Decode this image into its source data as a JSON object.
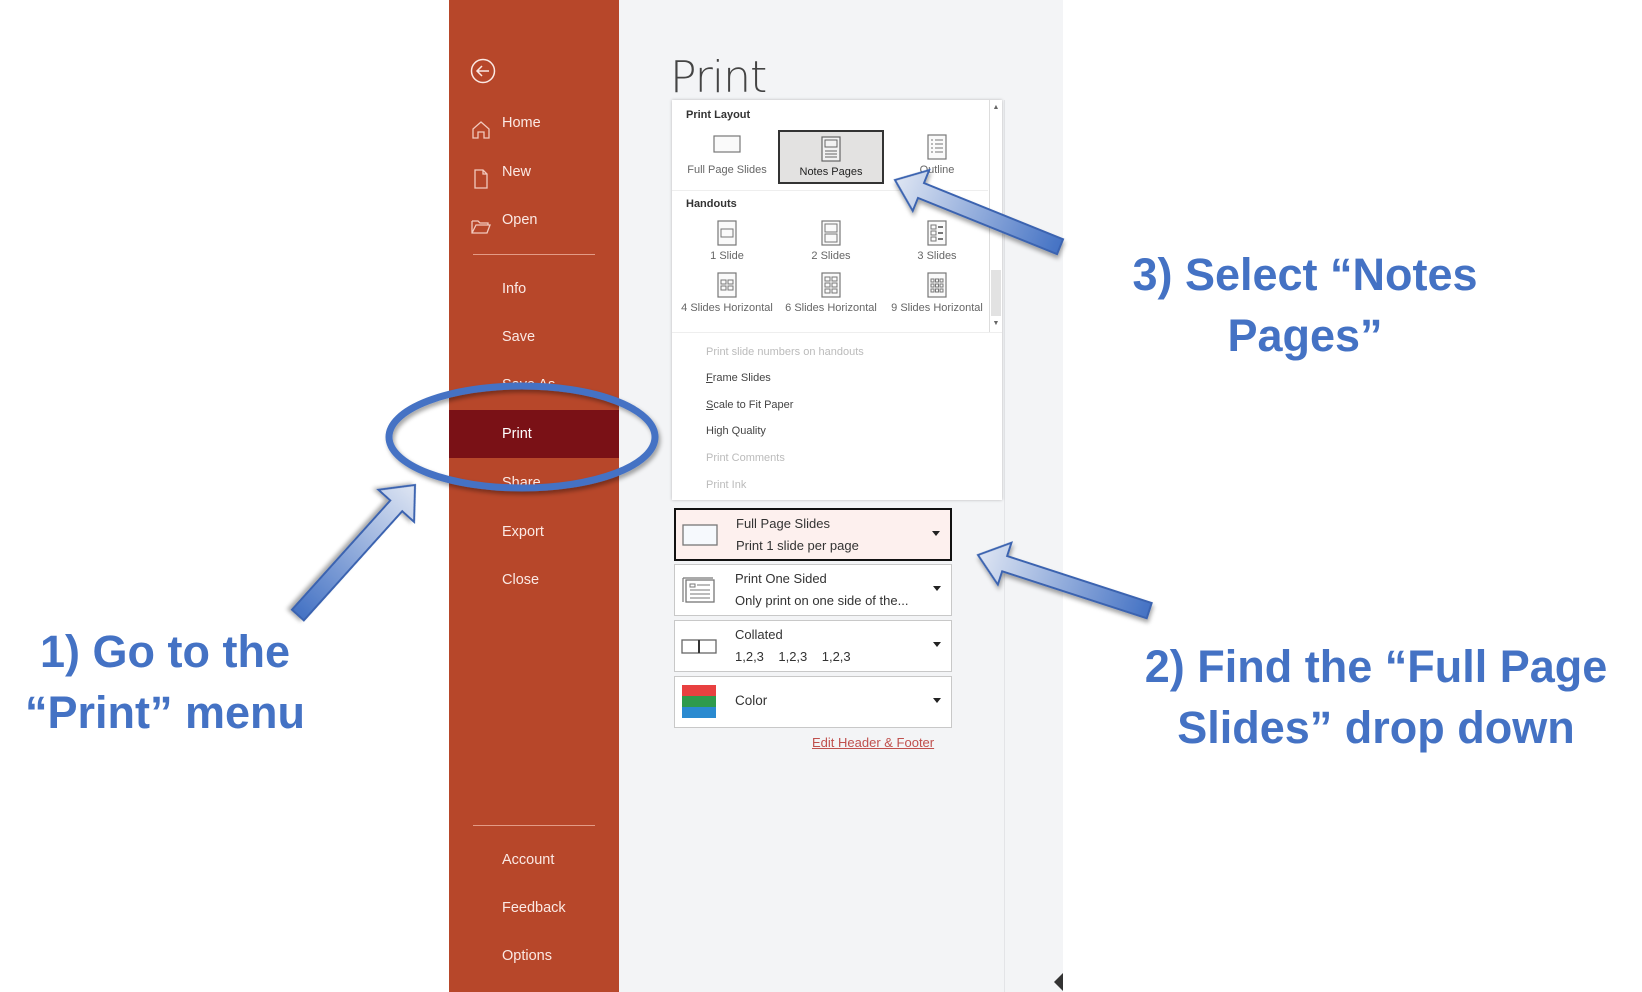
{
  "sidebar": {
    "back_label": "Back",
    "top_items": [
      {
        "label": "Home",
        "icon": "home-icon"
      },
      {
        "label": "New",
        "icon": "new-document-icon"
      },
      {
        "label": "Open",
        "icon": "open-folder-icon"
      }
    ],
    "middle_items": [
      {
        "label": "Info"
      },
      {
        "label": "Save"
      },
      {
        "label": "Save As"
      },
      {
        "label": "Print",
        "active": true
      },
      {
        "label": "Share"
      },
      {
        "label": "Export"
      },
      {
        "label": "Close"
      }
    ],
    "bottom_items": [
      {
        "label": "Account"
      },
      {
        "label": "Feedback"
      },
      {
        "label": "Options"
      }
    ]
  },
  "main": {
    "title": "Print",
    "layout_panel": {
      "print_layout_heading": "Print Layout",
      "print_layout_options": [
        {
          "label": "Full Page Slides",
          "selected": false
        },
        {
          "label": "Notes Pages",
          "selected": true
        },
        {
          "label": "Outline",
          "selected": false
        }
      ],
      "handouts_heading": "Handouts",
      "handout_options": [
        {
          "label": "1 Slide"
        },
        {
          "label": "2 Slides"
        },
        {
          "label": "3 Slides"
        },
        {
          "label": "4 Slides Horizontal"
        },
        {
          "label": "6 Slides Horizontal"
        },
        {
          "label": "9 Slides Horizontal"
        }
      ],
      "checkbox_options": [
        {
          "label": "Print slide numbers on handouts",
          "enabled": false
        },
        {
          "label": "Frame Slides",
          "enabled": true,
          "accel": "F"
        },
        {
          "label": "Scale to Fit Paper",
          "enabled": true,
          "accel": "S"
        },
        {
          "label": "High Quality",
          "enabled": true
        },
        {
          "label": "Print Comments",
          "enabled": false
        },
        {
          "label": "Print Ink",
          "enabled": false
        }
      ]
    },
    "settings": [
      {
        "line1": "Full Page Slides",
        "line2": "Print 1 slide per page",
        "icon": "full-page-slide-icon",
        "focused": true
      },
      {
        "line1": "Print One Sided",
        "line2": "Only print on one side of the...",
        "icon": "one-sided-icon"
      },
      {
        "line1": "Collated",
        "line2": "1,2,3    1,2,3    1,2,3",
        "icon": "collated-icon"
      },
      {
        "line1": "Color",
        "icon": "color-swatch-icon"
      }
    ],
    "edit_header_footer": "Edit Header & Footer"
  },
  "annotations": {
    "step1": [
      "1) Go to the",
      "“Print” menu"
    ],
    "step2": [
      "2) Find the “Full Page",
      "Slides” drop down"
    ],
    "step3": [
      "3) Select “Notes",
      "Pages”"
    ],
    "color": "#4472c4"
  },
  "colors": {
    "sidebar": "#b7472a",
    "sidebar_active": "#7a1116",
    "panel_bg": "#f3f4f6",
    "link": "#c0504d"
  }
}
